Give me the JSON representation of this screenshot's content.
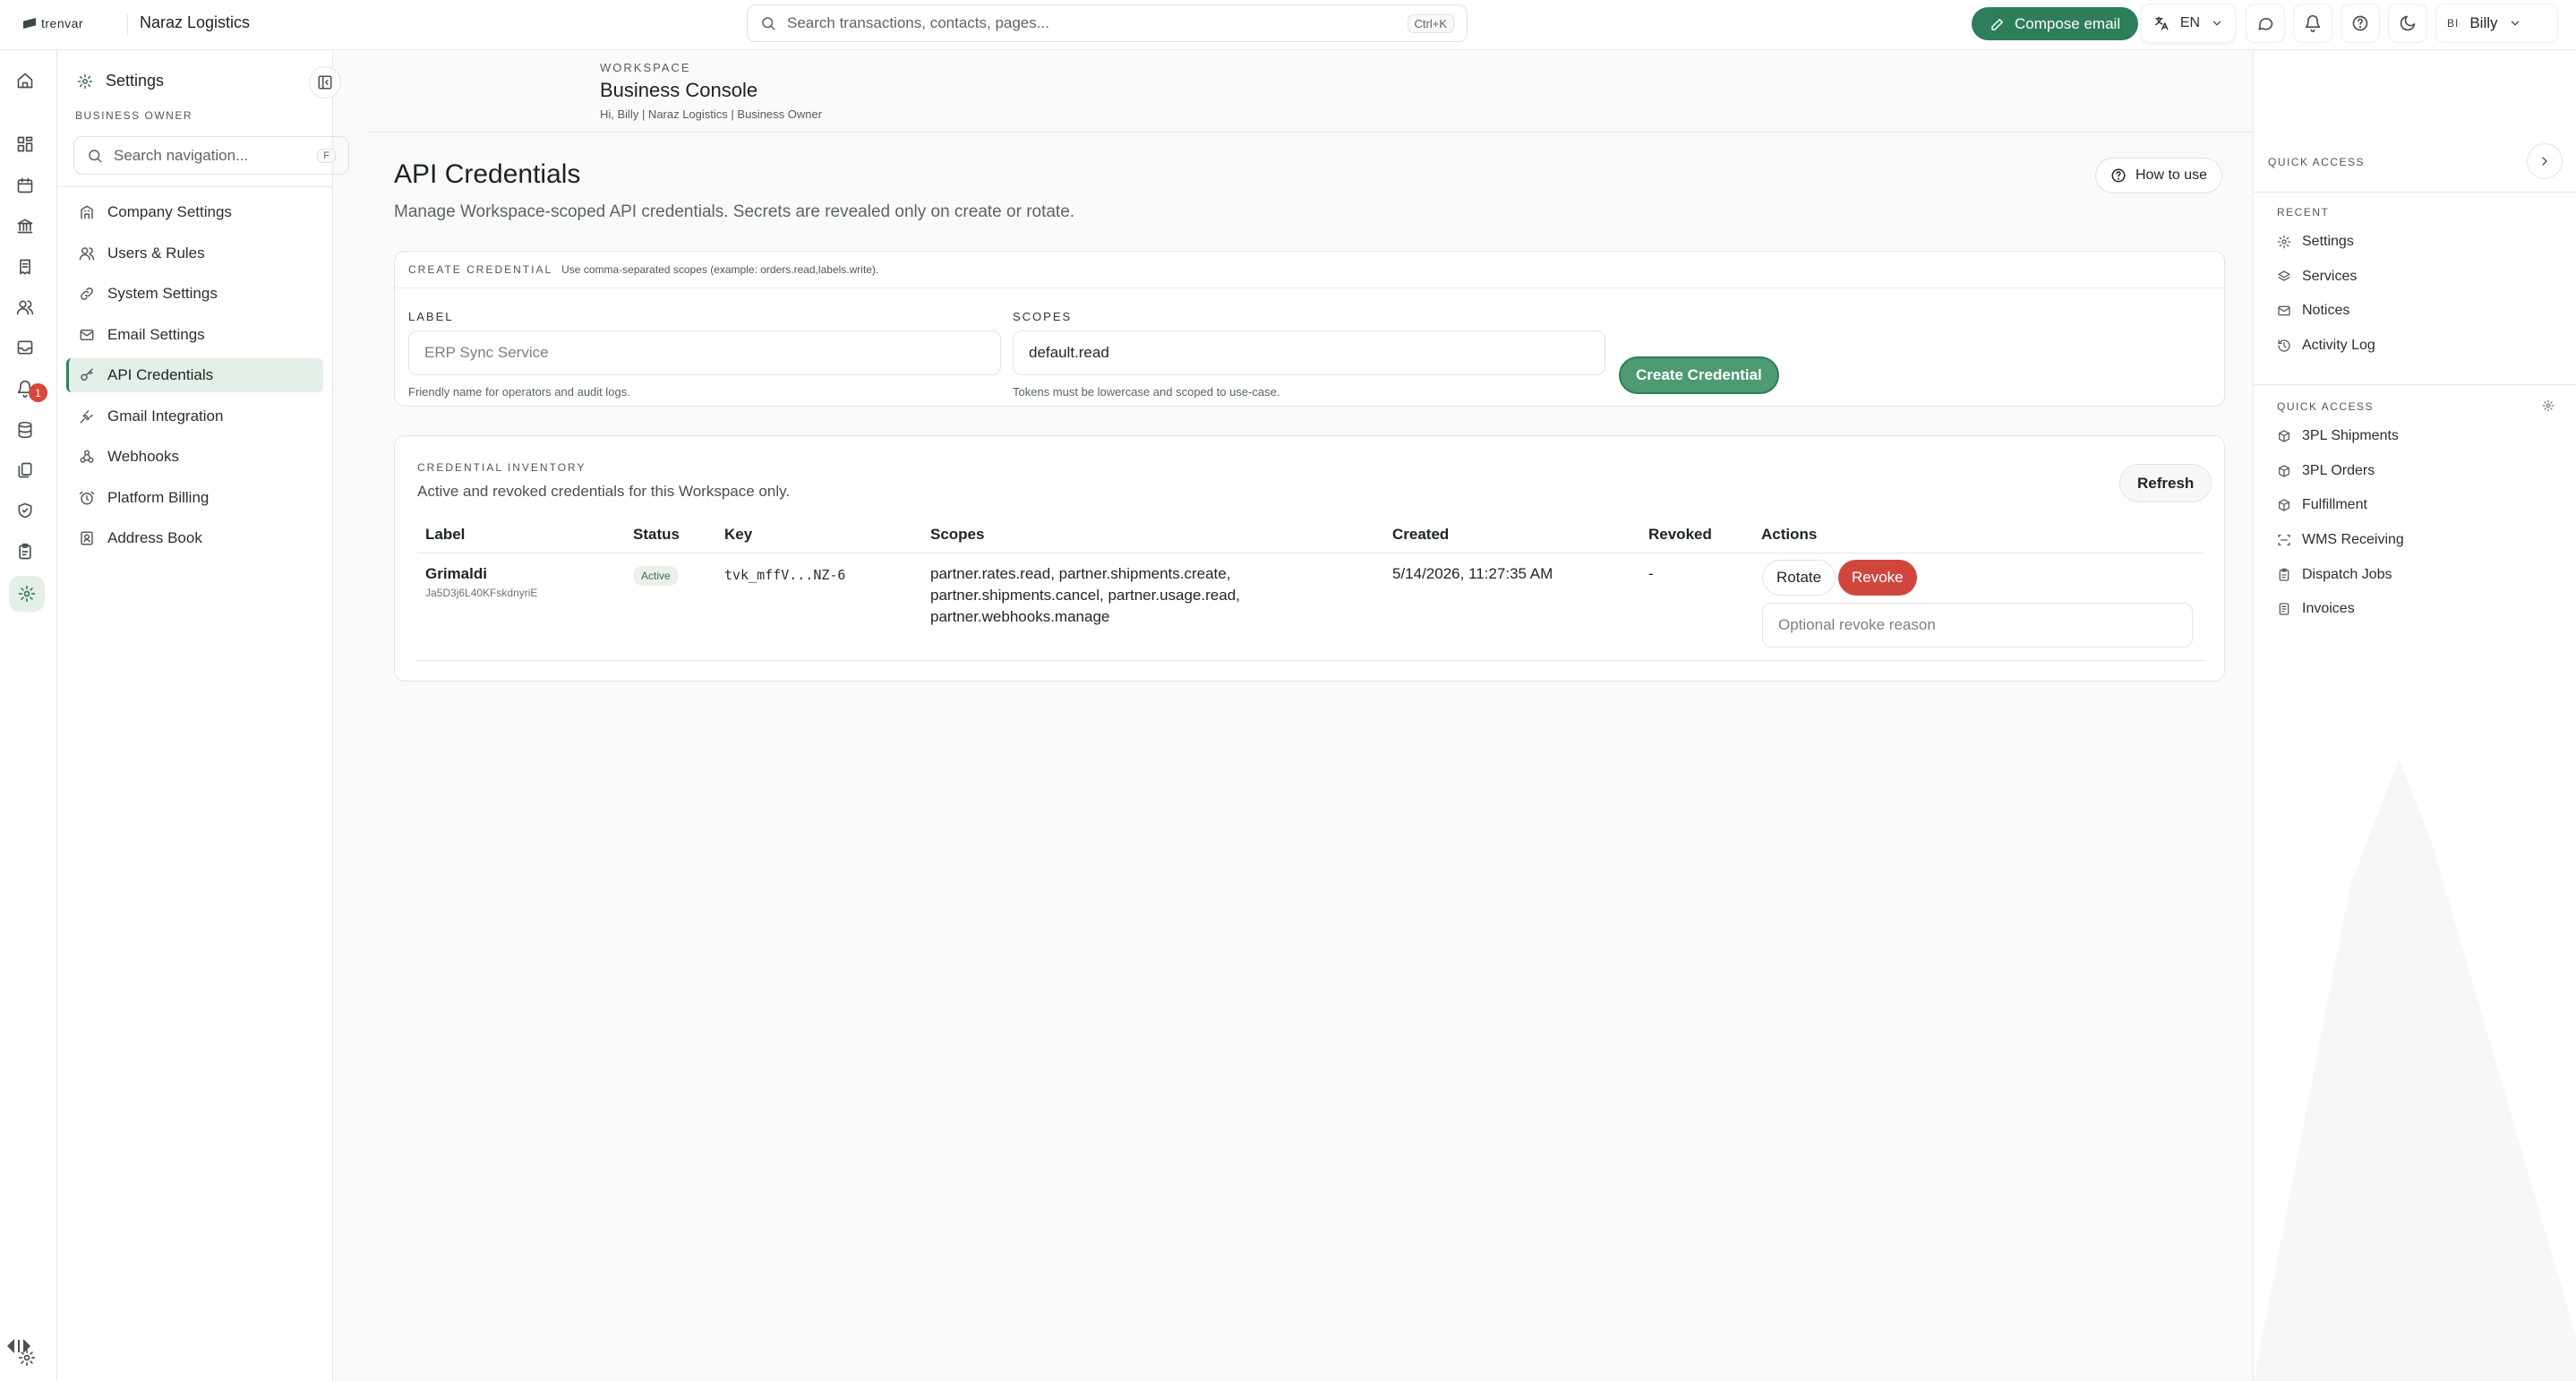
{
  "brand": {
    "name": "trenvar"
  },
  "header": {
    "company": "Naraz Logistics",
    "search_placeholder": "Search transactions, contacts, pages...",
    "search_shortcut": "Ctrl+K",
    "compose_label": "Compose email",
    "language": "EN",
    "user_initials": "BI",
    "user_name": "Billy"
  },
  "rail": {
    "items": [
      "home-icon",
      "dashboard-icon",
      "calendar-icon",
      "bank-icon",
      "receipt-icon",
      "users-icon",
      "inbox-icon",
      "bell-icon",
      "database-icon",
      "documents-icon",
      "shield-icon",
      "clipboard-icon",
      "settings-icon"
    ],
    "badge_count": "1",
    "footer_icon": "gear-icon"
  },
  "settings_panel": {
    "title": "Settings",
    "role": "BUSINESS OWNER",
    "search_placeholder": "Search navigation...",
    "search_shortcut": "F",
    "items": [
      {
        "label": "Company Settings",
        "icon": "building-icon"
      },
      {
        "label": "Users & Rules",
        "icon": "users-icon"
      },
      {
        "label": "System Settings",
        "icon": "link-icon"
      },
      {
        "label": "Email Settings",
        "icon": "mail-icon"
      },
      {
        "label": "API Credentials",
        "icon": "key-icon",
        "active": true
      },
      {
        "label": "Gmail Integration",
        "icon": "plug-icon"
      },
      {
        "label": "Webhooks",
        "icon": "webhook-icon"
      },
      {
        "label": "Platform Billing",
        "icon": "alarm-icon"
      },
      {
        "label": "Address Book",
        "icon": "book-icon"
      }
    ]
  },
  "workspace": {
    "label": "WORKSPACE",
    "title": "Business Console",
    "subtitle": "Hi, Billy | Naraz Logistics | Business Owner"
  },
  "page": {
    "title": "API Credentials",
    "description": "Manage Workspace-scoped API credentials. Secrets are revealed only on create or rotate.",
    "how_to_label": "How to use"
  },
  "create": {
    "overline": "CREATE CREDENTIAL",
    "hint": "Use comma-separated scopes (example: orders.read,labels.write).",
    "label_title": "LABEL",
    "label_placeholder": "ERP Sync Service",
    "label_help": "Friendly name for operators and audit logs.",
    "scopes_title": "SCOPES",
    "scopes_value": "default.read",
    "scopes_help": "Tokens must be lowercase and scoped to use-case.",
    "button_label": "Create Credential"
  },
  "inventory": {
    "overline": "CREDENTIAL INVENTORY",
    "description": "Active and revoked credentials for this Workspace only.",
    "refresh_label": "Refresh",
    "columns": [
      "Label",
      "Status",
      "Key",
      "Scopes",
      "Created",
      "Revoked",
      "Actions"
    ],
    "rows": [
      {
        "name": "Grimaldi",
        "id": "Ja5D3j6L40KFskdnyriE",
        "status": "Active",
        "key": "tvk_mffV...NZ-6",
        "scopes": "partner.rates.read, partner.shipments.create, partner.shipments.cancel, partner.usage.read, partner.webhooks.manage",
        "created": "5/14/2026, 11:27:35 AM",
        "revoked": "-",
        "rotate_label": "Rotate",
        "revoke_label": "Revoke",
        "reason_placeholder": "Optional revoke reason"
      }
    ]
  },
  "quick_access": {
    "title": "QUICK ACCESS",
    "recent_title": "RECENT",
    "recent": [
      {
        "label": "Settings",
        "icon": "gear-icon"
      },
      {
        "label": "Services",
        "icon": "layers-icon"
      },
      {
        "label": "Notices",
        "icon": "mail-icon"
      },
      {
        "label": "Activity Log",
        "icon": "history-icon"
      }
    ],
    "links_title": "QUICK ACCESS",
    "links": [
      {
        "label": "3PL Shipments",
        "icon": "package-icon"
      },
      {
        "label": "3PL Orders",
        "icon": "package-icon"
      },
      {
        "label": "Fulfillment",
        "icon": "package-icon"
      },
      {
        "label": "WMS Receiving",
        "icon": "scan-icon"
      },
      {
        "label": "Dispatch Jobs",
        "icon": "clipboard-icon"
      },
      {
        "label": "Invoices",
        "icon": "invoice-icon"
      }
    ]
  },
  "colors": {
    "accent": "#2e7d5b",
    "danger": "#d0463f",
    "active_bg": "#e4efe8"
  }
}
